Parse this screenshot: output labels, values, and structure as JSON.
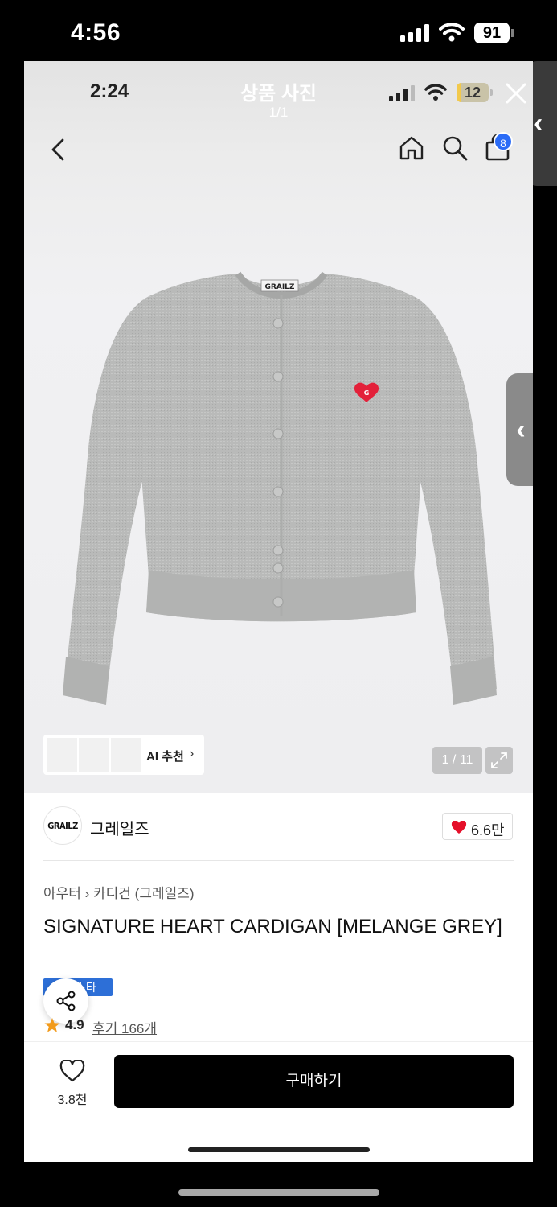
{
  "outer_status": {
    "time": "4:56",
    "battery": "91"
  },
  "viewer": {
    "title": "상품 사진",
    "count": "1/1",
    "inner_time": "2:24",
    "inner_battery": "12"
  },
  "header": {
    "cart_badge": "8"
  },
  "image": {
    "tag_text": "GRAILZ",
    "ai_label": "AI 추천",
    "ai_arrow": "›",
    "page_indicator": "1 / 11"
  },
  "brand": {
    "logo_text": "GRAILZ",
    "name": "그레일즈",
    "likes": "6.6만"
  },
  "product": {
    "breadcrumb": "아우터 › 카디건 (그레일즈)",
    "title": "SIGNATURE HEART CARDIGAN [MELANGE GREY]",
    "badge_visible": "스타",
    "rating": "4.9",
    "reviews": "후기 166개"
  },
  "bottom_bar": {
    "wish_count": "3.8천",
    "buy_label": "구매하기"
  },
  "colors": {
    "accent_blue": "#2b6cf6",
    "heart_red": "#e5102a",
    "star_orange": "#f29a1a",
    "buy_button": "#000000",
    "sweater_grey": "#b8b9b8"
  }
}
